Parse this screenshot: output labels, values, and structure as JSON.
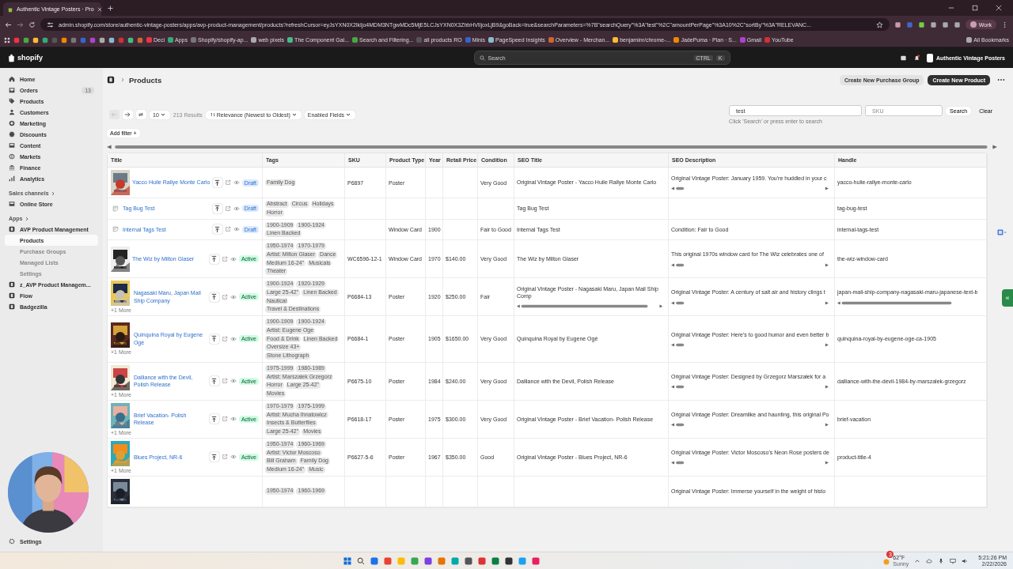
{
  "browser": {
    "tab_title": "Authentic Vintage Posters · Pro",
    "url": "admin.shopify.com/store/authentic-vintage-posters/apps/avp-product-management/products?refreshCursor=eyJsYXN0X2lkIjo4MDM3NTgwMDc5MjE5LCJsYXN0X3ZhbHVlIjoxLjB9&goBack=true&searchParameters=%7B\"searchQuery\"%3A\"test\"%2C\"amountPerPage\"%3A10%2C\"sortBy\"%3A\"RELEVANC...",
    "profile": "Work",
    "bookmarks": [
      "Deci",
      "Apps",
      "Shopify/shopify-ap...",
      "web pixels",
      "The Component Gal...",
      "Search and Filtering...",
      "all products RO",
      "Minis",
      "PageSpeed Insights",
      "Overview - Merchan...",
      "benjaminr/chrome-...",
      "JadePuma · Plan · S...",
      "Gmail",
      "YouTube"
    ],
    "all_bookmarks": "All Bookmarks"
  },
  "shopify": {
    "logo": "shopify",
    "search_placeholder": "Search",
    "shortcut": [
      "CTRL",
      "K"
    ],
    "store": "Authentic Vintage Posters"
  },
  "sidebar": {
    "items": [
      {
        "label": "Home",
        "selected": false
      },
      {
        "label": "Orders",
        "badge": "13",
        "selected": false
      },
      {
        "label": "Products",
        "selected": false
      },
      {
        "label": "Customers",
        "selected": false
      },
      {
        "label": "Marketing",
        "selected": false
      },
      {
        "label": "Discounts",
        "selected": false
      },
      {
        "label": "Content",
        "selected": false
      },
      {
        "label": "Markets",
        "selected": false
      },
      {
        "label": "Finance",
        "selected": false
      },
      {
        "label": "Analytics",
        "selected": false
      }
    ],
    "sales_channels": {
      "heading": "Sales channels",
      "items": [
        {
          "label": "Online Store"
        }
      ]
    },
    "apps": {
      "heading": "Apps",
      "items": [
        {
          "label": "AVP Product Management",
          "children": [
            {
              "label": "Products",
              "selected": true
            },
            {
              "label": "Purchase Groups",
              "selected": false
            },
            {
              "label": "Managed Lists",
              "selected": false
            },
            {
              "label": "Settings",
              "selected": false
            }
          ]
        },
        {
          "label": "z_AVP Product Managem..."
        },
        {
          "label": "Flow"
        },
        {
          "label": "Badgezilla"
        }
      ]
    },
    "settings": "Settings"
  },
  "page": {
    "title": "Products",
    "actions": [
      {
        "label": "Create New Purchase Group",
        "kind": "secondary"
      },
      {
        "label": "Create New Product",
        "kind": "primary"
      }
    ],
    "toolbar": {
      "back_disabled": true,
      "page_size": "10",
      "results": "213 Results",
      "sort": "Relevance (Newest to Oldest)",
      "fields": "Enabled Fields"
    },
    "search": {
      "value": "test",
      "sku_placeholder": "SKU",
      "button": "Search",
      "clear": "Clear",
      "hint": "Click 'Search' or press enter to search"
    },
    "add_filter": "Add filter +"
  },
  "table": {
    "columns": [
      "Title",
      "Tags",
      "SKU",
      "Product Type",
      "Year",
      "Retail Price",
      "Condition",
      "SEO Title",
      "SEO Description",
      "Handle"
    ],
    "rows": [
      {
        "title": "Yacco Huile Rallye Monte Carlo",
        "image": true,
        "status": "Draft",
        "tags": [
          "Family Dog"
        ],
        "sku": "P6897",
        "type": "Poster",
        "condition": "Very Good",
        "seo_title": "Original Vintage Poster - Yacco Huile Rallye Monte Carlo",
        "seo_description": "Original Vintage Poster: January 1959. You're huddled in your c",
        "handle": "yacco-huile-rallye-monte-carlo",
        "desc_scroll": true,
        "wide_scroll": false
      },
      {
        "title": "Tag Bug Test",
        "image": false,
        "status": "Draft",
        "tags": [
          "Abstract",
          "Circus",
          "Holidays",
          "Horror"
        ],
        "seo_title": "Tag Bug Test",
        "handle": "tag-bug-test",
        "desc_scroll": false,
        "wide_scroll": false
      },
      {
        "title": "Internal Tags Test",
        "image": false,
        "status": "Draft",
        "tags": [
          "1900-1909",
          "1900-1924",
          "Linen Backed"
        ],
        "type": "Window Card",
        "year": "1900",
        "condition": "Fair to Good",
        "seo_title": "Internal Tags Test",
        "seo_description": "Condition: Fair to Good",
        "handle": "internal-tags-test",
        "desc_scroll": false,
        "wide_scroll": false
      },
      {
        "title": "The Wiz by Milton Glaser",
        "image": true,
        "status": "Active",
        "tags": [
          "1950-1974",
          "1970-1979",
          "Artist: Milton Glaser",
          "Dance",
          "Medium 16-24\"",
          "Musicals",
          "Theater"
        ],
        "sku": "WC6596-12-1",
        "type": "Window Card",
        "year": "1970",
        "price": "$140.00",
        "condition": "Very Good",
        "seo_title": "The Wiz by Milton Glaser",
        "seo_description": "This original 1970s window card for The Wiz celebrates one of",
        "handle": "the-wiz-window-card",
        "desc_scroll": true,
        "wide_scroll": false
      },
      {
        "title": "Nagasaki Maru, Japan Mail Ship Company",
        "image": true,
        "more": "+1 More",
        "status": "Active",
        "tags": [
          "1900-1924",
          "1920-1929",
          "Large 25-42\"",
          "Linen Backed",
          "Nautical",
          "Travel & Destinations"
        ],
        "sku": "P6684-13",
        "type": "Poster",
        "year": "1920",
        "price": "$250.00",
        "condition": "Fair",
        "seo_title": "Original Vintage Poster - Nagasaki Maru, Japan Mail Ship Comp",
        "seo_description": "Original Vintage Poster: A century of salt air and history clings t",
        "handle": "japan-mail-ship-company-nagasaki-maru-japanese-text-b",
        "desc_scroll": true,
        "wide_scroll": true
      },
      {
        "title": "Quinquina Royal by Eugene Ogé",
        "image": true,
        "more": "+1 More",
        "status": "Active",
        "tags": [
          "1900-1909",
          "1900-1924",
          "Artist: Eugene Oge",
          "Food & Drink",
          "Linen Backed",
          "Oversize 43+",
          "Stone Lithograph"
        ],
        "sku": "P6684-1",
        "type": "Poster",
        "year": "1905",
        "price": "$1650.00",
        "condition": "Very Good",
        "seo_title": "Quinquina Royal by Eugene Ogé",
        "seo_description": "Original Vintage Poster: Here's to good humor and even better b",
        "handle": "quinquina-royal-by-eugene-oge-ca-1905",
        "desc_scroll": true,
        "wide_scroll": false
      },
      {
        "title": "Dalliance with the Devil, Polish Release",
        "image": true,
        "more": "+1 More",
        "status": "Active",
        "tags": [
          "1975-1999",
          "1980-1989",
          "Artist: Marszalek Grzegorz",
          "Horror",
          "Large 25-42\"",
          "Movies"
        ],
        "sku": "P6675-10",
        "type": "Poster",
        "year": "1984",
        "price": "$240.00",
        "condition": "Very Good",
        "seo_title": "Dalliance with the Devil, Polish Release",
        "seo_description": "Original Vintage Poster: Designed by Grzegorz Marszałek for a",
        "handle": "dalliance-with-the-devil-1984-by-marszalek-grzegorz",
        "desc_scroll": true,
        "wide_scroll": false
      },
      {
        "title": "Brief Vacation- Polish Release",
        "image": true,
        "more": "+1 More",
        "status": "Active",
        "tags": [
          "1970-1979",
          "1975-1999",
          "Artist: Mucha Ihnatowicz",
          "Insects & Butterflies",
          "Large 25-42\"",
          "Movies"
        ],
        "sku": "P6618-17",
        "type": "Poster",
        "year": "1975",
        "price": "$300.00",
        "condition": "Very Good",
        "seo_title": "Original Vintage Poster - Brief Vacation- Polish Release",
        "seo_description": "Original Vintage Poster: Dreamlike and haunting, this original Po",
        "handle": "brief-vacation",
        "desc_scroll": true,
        "wide_scroll": false
      },
      {
        "title": "Blues Project, NR-6",
        "image": true,
        "more": "+1 More",
        "status": "Active",
        "tags": [
          "1950-1974",
          "1960-1969",
          "Artist: Victor Moscoso",
          "Bill Graham",
          "Family Dog",
          "Medium 16-24\"",
          "Music"
        ],
        "sku": "P6627-5-6",
        "type": "Poster",
        "year": "1967",
        "price": "$350.00",
        "condition": "Good",
        "seo_title": "Original Vintage Poster - Blues Project, NR-6",
        "seo_description": "Original Vintage Poster: Victor Moscoso's Neon Rose posters de",
        "handle": "product-title-4",
        "desc_scroll": true,
        "wide_scroll": false
      },
      {
        "image": true,
        "tags": [
          "1950-1974",
          "1960-1969"
        ],
        "seo_description": "Original Vintage Poster: Immerse yourself in the weight of histo",
        "desc_scroll": false,
        "wide_scroll": false
      }
    ]
  },
  "collapse_button": "«",
  "taskbar": {
    "weather": {
      "badge": "3",
      "temp": "62°F",
      "condition": "Sunny"
    },
    "time": "5:21:26 PM",
    "date": "2/22/2026"
  }
}
